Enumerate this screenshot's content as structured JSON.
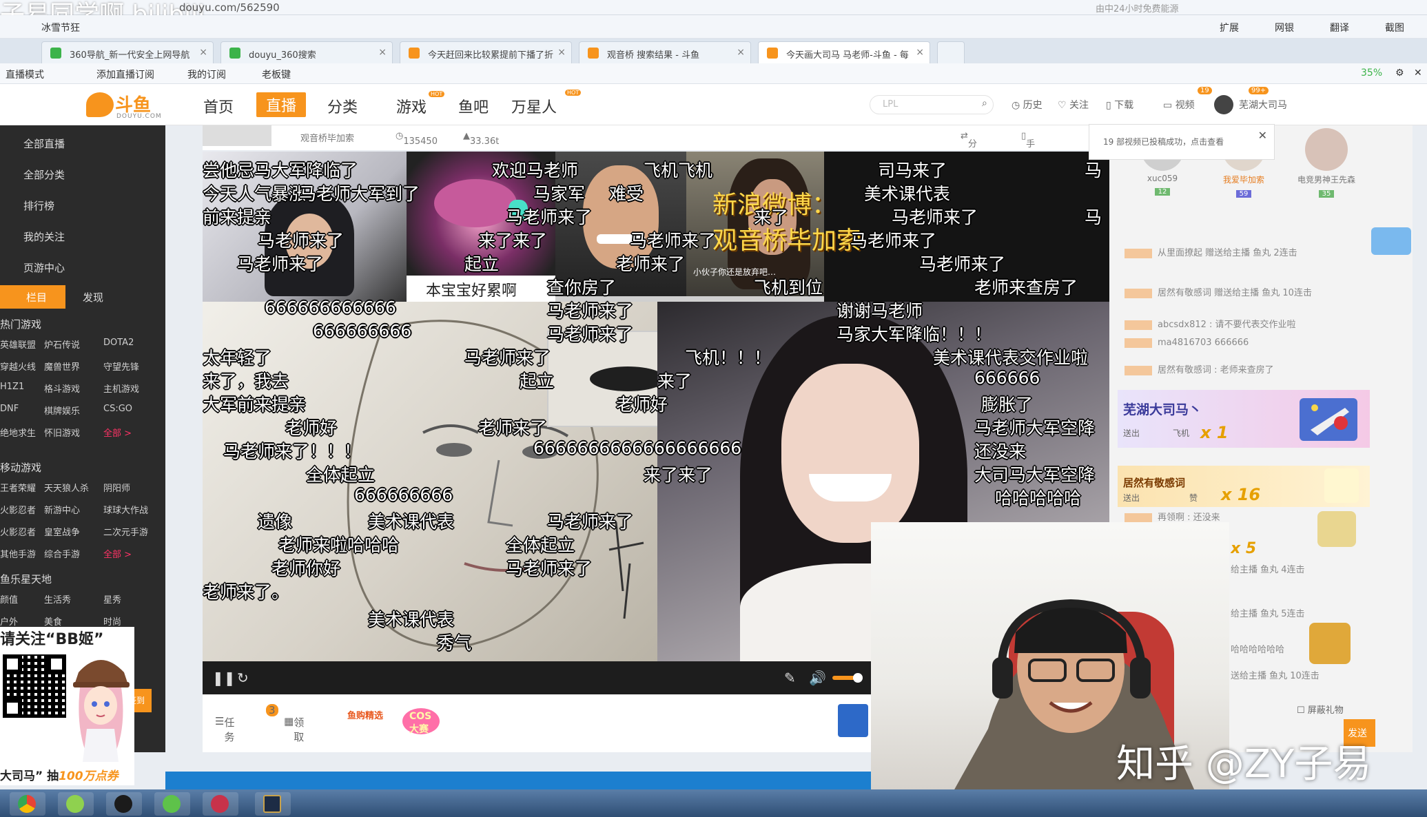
{
  "browser": {
    "url": "douyu.com/562590",
    "search_hint": "由中24小时免费能源",
    "bookmarks": [
      "冰雪节狂"
    ],
    "toolbar": [
      "扩展",
      "网银",
      "翻译",
      "截图"
    ],
    "tabs": [
      {
        "label": "360导航_新一代安全上网导航",
        "color": "#3cb34a"
      },
      {
        "label": "douyu_360搜索",
        "color": "#3cb34a"
      },
      {
        "label": "今天赶回来比较累提前下播了折",
        "color": "#f7941d"
      },
      {
        "label": "观音桥 搜索结果 - 斗鱼",
        "color": "#f7941d"
      },
      {
        "label": "今天画大司马 马老师-斗鱼 - 每",
        "color": "#f7941d",
        "active": true
      }
    ],
    "ext_bar": [
      "直播模式",
      "添加直播订阅",
      "我的订阅",
      "老板键"
    ],
    "zoom_pct": "35%"
  },
  "header": {
    "logo_text": "斗鱼",
    "logo_sub": "DOUYU.COM",
    "nav": [
      "首页",
      "直播",
      "分类",
      "游戏",
      "鱼吧",
      "万星人"
    ],
    "nav_active_index": 1,
    "hot_label": "HOT",
    "search_placeholder": "LPL",
    "links": [
      "历史",
      "关注",
      "下载",
      "视频"
    ],
    "video_badge": "19",
    "user_badge": "99+",
    "username": "芜湖大司马"
  },
  "sidebar": {
    "items": [
      "全部直播",
      "全部分类",
      "排行榜",
      "我的关注",
      "页游中心"
    ],
    "tab_active": "栏目",
    "tab_other": "发现",
    "sections": [
      {
        "title": "热门游戏",
        "cells": [
          "英雄联盟",
          "炉石传说",
          "DOTA2",
          "穿越火线",
          "魔兽世界",
          "守望先锋",
          "H1Z1",
          "格斗游戏",
          "主机游戏",
          "DNF",
          "棋牌娱乐",
          "CS:GO",
          "绝地求生",
          "怀旧游戏",
          "全部 >"
        ]
      },
      {
        "title": "移动游戏",
        "cells": [
          "王者荣耀",
          "天天狼人杀",
          "阴阳师",
          "火影忍者",
          "新游中心",
          "球球大作战",
          "火影忍者",
          "皇室战争",
          "二次元手游",
          "其他手游",
          "综合手游",
          "全部 >"
        ]
      },
      {
        "title": "鱼乐星天地",
        "cells": [
          "颜值",
          "生活秀",
          "星秀",
          "户外",
          "美食",
          "时尚"
        ]
      }
    ],
    "promo_title": "请关注“BB姬”",
    "promo_foot_prefix": "大司马” 抽",
    "promo_foot_prize": "100万点券",
    "side_btn": "签到"
  },
  "room": {
    "anchor": "观音桥毕加索",
    "viewers": "135450",
    "weight": "33.36t",
    "share": "分享",
    "phone": "手机看直播"
  },
  "video": {
    "weibo_label": "新浪微博：",
    "weibo_name": "观音桥毕加索",
    "caption": "本宝宝好累啊",
    "small_text": "小伙子你还是放弃吧…",
    "danmaku": [
      "尝他忌马大军降临了",
      "欢迎马老师",
      "飞机飞机",
      "司马来了",
      "马",
      "今天人气暴涨",
      "马老师大军到了",
      "马家军",
      "难受",
      "美术课代表",
      "前来提亲",
      "马老师来了",
      "来了",
      "马老师来了",
      "马",
      "马老师来了",
      "来了来了",
      "马老师来了",
      "马老师来了",
      "马老师来了",
      "起立",
      "老师来了",
      "马老师来了",
      "查你房了",
      "飞机到位",
      "老师来查房了",
      "666666666666",
      "马老师来了",
      "谢谢马老师",
      "666666666",
      "马老师来了",
      "马家大军降临！！！",
      "太年轻了",
      "马老师来了",
      "飞机！！！",
      "美术课代表交作业啦",
      "来了，我去",
      "起立",
      "来了",
      "666666",
      "大军前来提亲",
      "老师好",
      "膨胀了",
      "老师好",
      "老师来了",
      "马老师大军空降",
      "马老师来了！！！",
      "6666666666666666666",
      "还没来",
      "全体起立",
      "来了来了",
      "大司马大军空降",
      "666666666",
      "哈哈哈哈哈",
      "遗像",
      "美术课代表",
      "马老师来了",
      "老师来啦哈哈哈",
      "全体起立",
      "老师你好",
      "马老师来了",
      "老师来了。",
      "美术课代表",
      "秀气"
    ]
  },
  "below_video": {
    "task": "任务",
    "task_badge": "3",
    "claim": "领取",
    "shop": "鱼购精选",
    "cos": "COS大赛"
  },
  "chat": {
    "notice": "19 部视频已投稿成功，点击查看",
    "fans": [
      {
        "name": "xuc059",
        "level": "12",
        "color": "#6fb96f"
      },
      {
        "name": "我爱毕加索",
        "level": "59",
        "color": "#6c6cd8"
      },
      {
        "name": "电竞男神王先森",
        "level": "35",
        "color": "#6fb96f"
      }
    ],
    "lines": [
      "从里面撩起 赠送给主播 鱼丸  2连击",
      "居然有敬感词 赠送给主播 鱼丸  10连击",
      "abcsdx812 : 请不要代表交作业啦",
      "ma4816703 666666",
      "居然有敬感词 : 老师来查房了"
    ],
    "banner1_name": "芜湖大司马丶",
    "banner1_sub": "送出",
    "banner1_gift": "飞机",
    "banner1_count": "x 1",
    "banner2_name": "居然有敬感词",
    "banner2_sub": "送出",
    "banner2_gift": "赞",
    "banner2_count": "x 16",
    "lines2": [
      "再领啊 : 还没来",
      "x 5",
      "给主播 鱼丸 4连击",
      "给主播 鱼丸 5连击",
      "哈哈哈哈哈哈",
      "送给主播 鱼丸 10连击"
    ],
    "shield_gift": "屏蔽礼物",
    "send": "发送"
  },
  "watermarks": {
    "bilibili": "子易同学啊 bilibili",
    "zhihu": "知乎 @ZY子易"
  },
  "taskbar": {
    "apps": [
      "chrome",
      "360",
      "steam",
      "360safe",
      "game",
      "lol"
    ]
  }
}
